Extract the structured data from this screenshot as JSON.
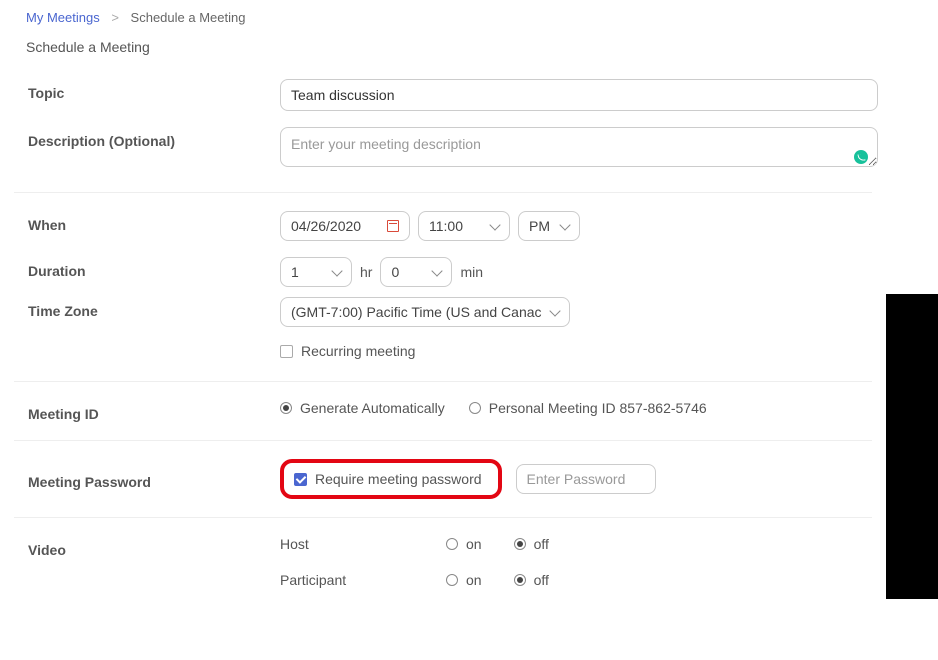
{
  "breadcrumb": {
    "root": "My Meetings",
    "current": "Schedule a Meeting"
  },
  "page_title": "Schedule a Meeting",
  "labels": {
    "topic": "Topic",
    "description": "Description (Optional)",
    "when": "When",
    "duration": "Duration",
    "time_zone": "Time Zone",
    "meeting_id": "Meeting ID",
    "meeting_password": "Meeting Password",
    "video": "Video",
    "hr": "hr",
    "min": "min",
    "host": "Host",
    "participant": "Participant",
    "on": "on",
    "off": "off"
  },
  "values": {
    "topic": "Team discussion",
    "description_placeholder": "Enter your meeting description",
    "date": "04/26/2020",
    "time": "11:00",
    "ampm": "PM",
    "duration_hr": "1",
    "duration_min": "0",
    "timezone": "(GMT-7:00) Pacific Time (US and Canac",
    "recurring_label": "Recurring meeting",
    "mid_generate": "Generate Automatically",
    "mid_personal": "Personal Meeting ID 857-862-5746",
    "require_password": "Require meeting password",
    "password_placeholder": "Enter Password"
  },
  "state": {
    "recurring_checked": false,
    "mid_selected": "generate",
    "require_password_checked": true,
    "host_video": "off",
    "participant_video": "off"
  }
}
